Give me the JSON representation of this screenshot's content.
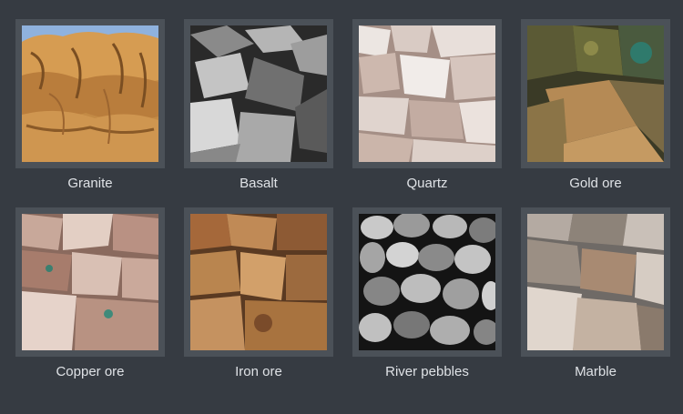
{
  "gallery": {
    "items": [
      {
        "label": "Granite",
        "thumbnail": "granite-rock-image"
      },
      {
        "label": "Basalt",
        "thumbnail": "basalt-rock-image"
      },
      {
        "label": "Quartz",
        "thumbnail": "quartz-rock-image"
      },
      {
        "label": "Gold ore",
        "thumbnail": "gold-ore-image"
      },
      {
        "label": "Copper ore",
        "thumbnail": "copper-ore-image"
      },
      {
        "label": "Iron ore",
        "thumbnail": "iron-ore-image"
      },
      {
        "label": "River pebbles",
        "thumbnail": "river-pebbles-image"
      },
      {
        "label": "Marble",
        "thumbnail": "marble-rock-image"
      }
    ]
  },
  "colors": {
    "background": "#363b42",
    "frame_border": "#4b5158",
    "label_text": "#dfe2e6"
  }
}
